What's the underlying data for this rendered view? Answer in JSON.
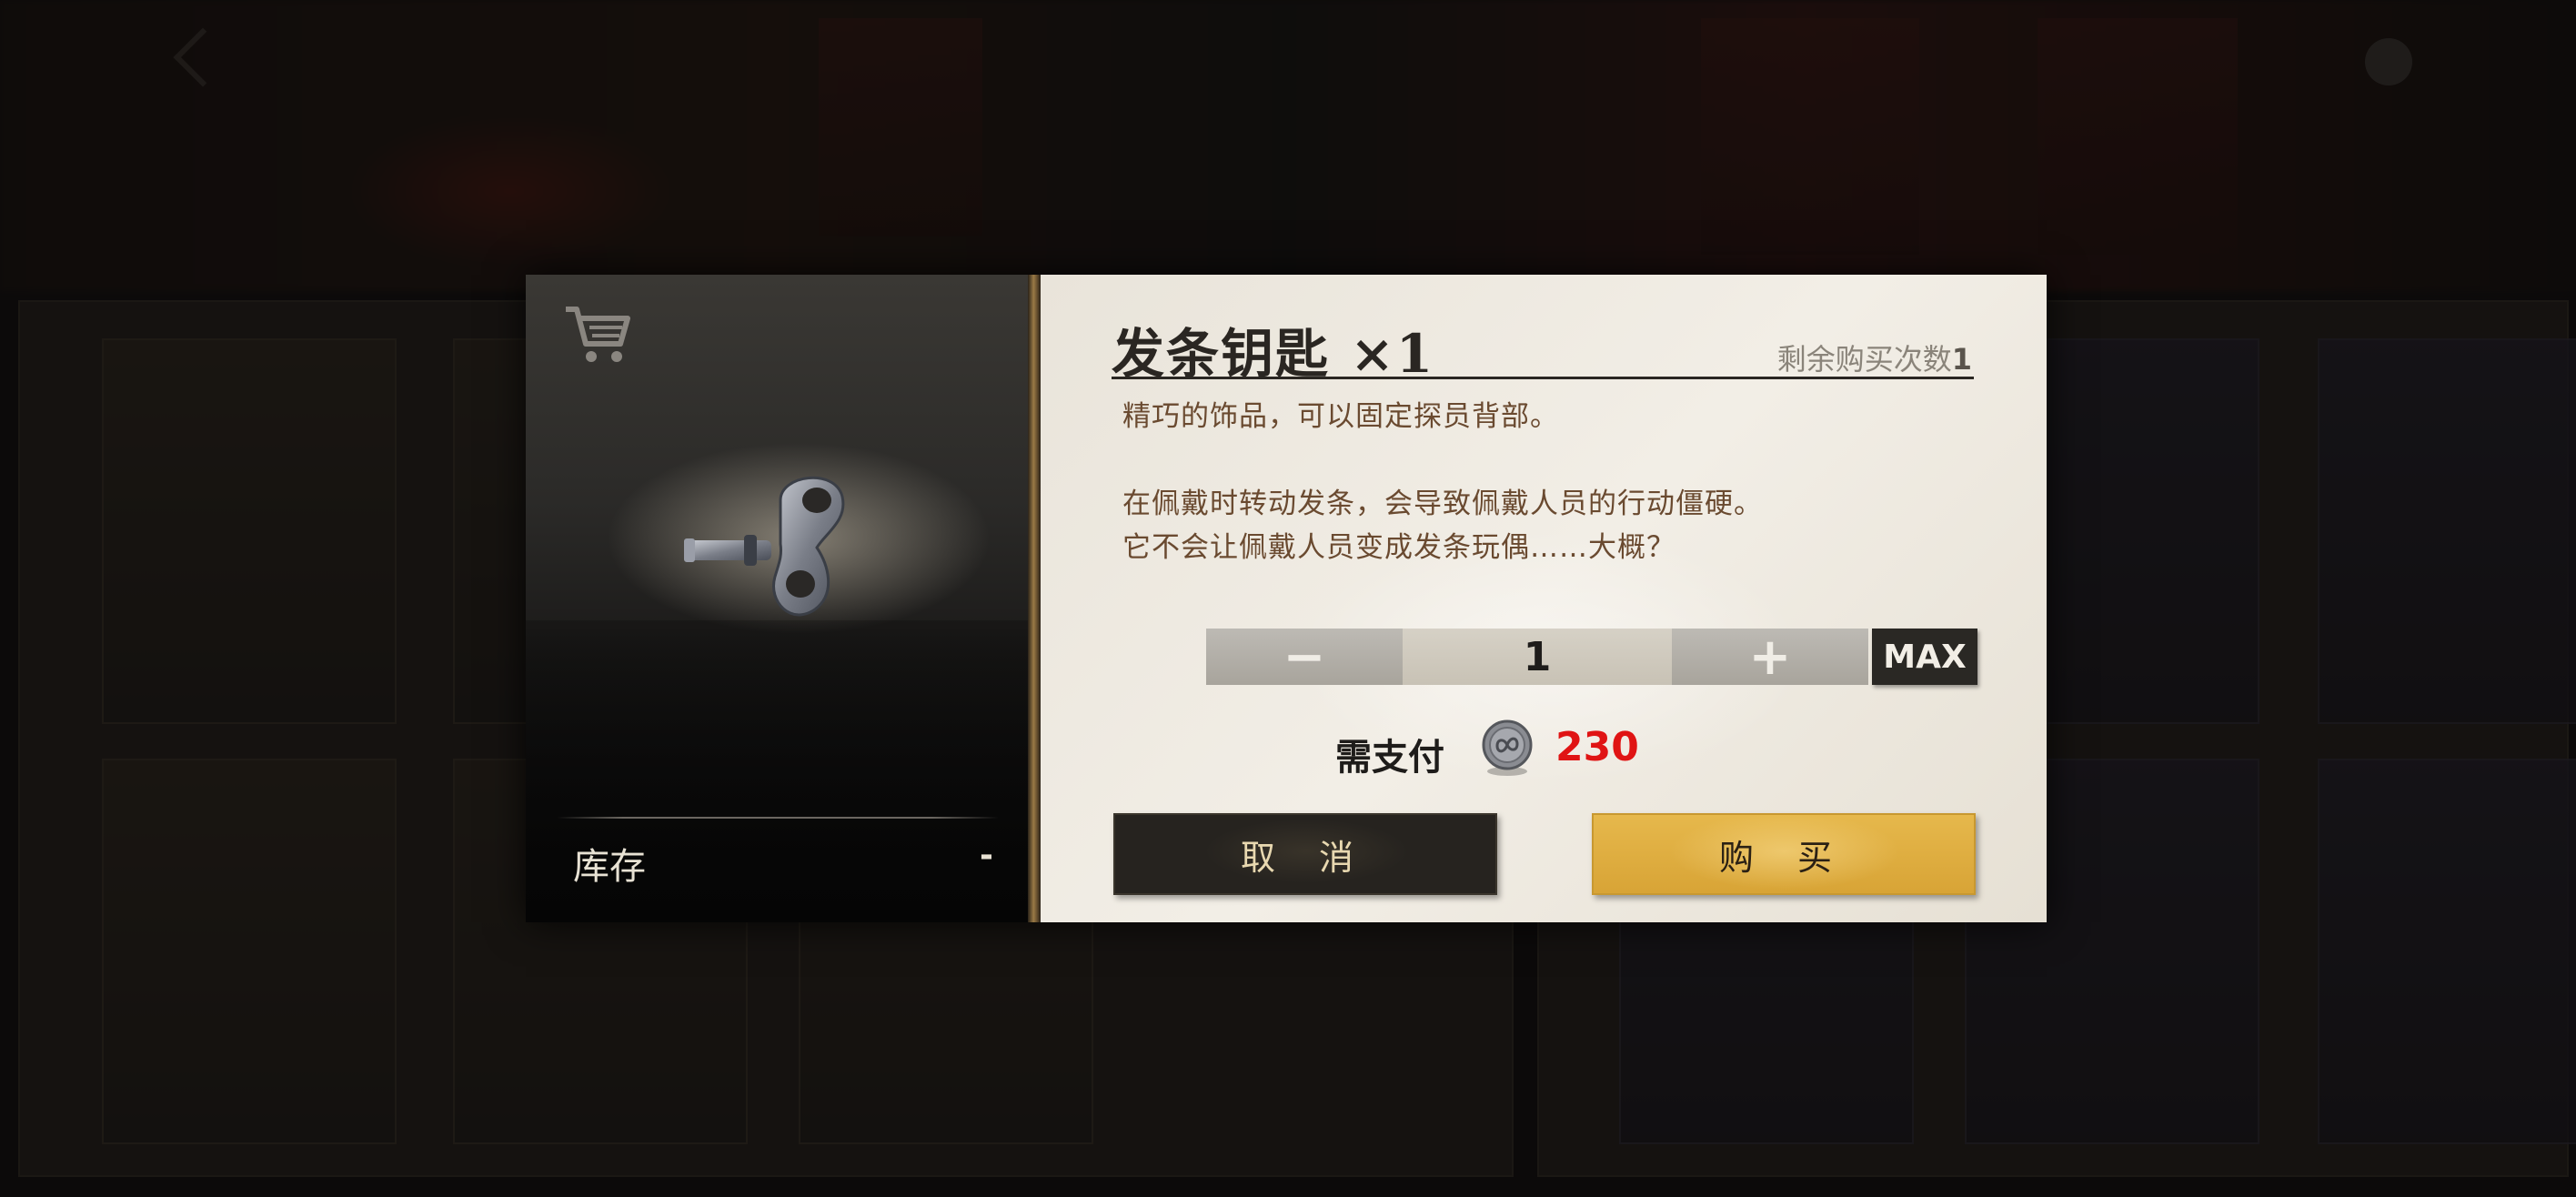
{
  "item": {
    "title": "发条钥匙 ×1",
    "remaining_label": "剩余购买次数",
    "remaining_count": "1",
    "description": [
      "精巧的饰品，可以固定探员背部。",
      "",
      "在佩戴时转动发条，会导致佩戴人员的行动僵硬。",
      "它不会让佩戴人员变成发条玩偶……大概？"
    ]
  },
  "stock": {
    "label": "库存",
    "value": "-"
  },
  "quantity": {
    "minus": "−",
    "value": "1",
    "plus": "+",
    "max_label": "MAX"
  },
  "payment": {
    "label": "需支付",
    "amount": "230",
    "amount_color": "#e01414"
  },
  "buttons": {
    "cancel": "取 消",
    "buy": "购 买"
  },
  "icons": {
    "shop": "shopping-cart-icon",
    "currency": "coin-icon"
  },
  "colors": {
    "accent_gold": "#d8a436",
    "price_red": "#e01414",
    "dark_button": "#26231f"
  }
}
